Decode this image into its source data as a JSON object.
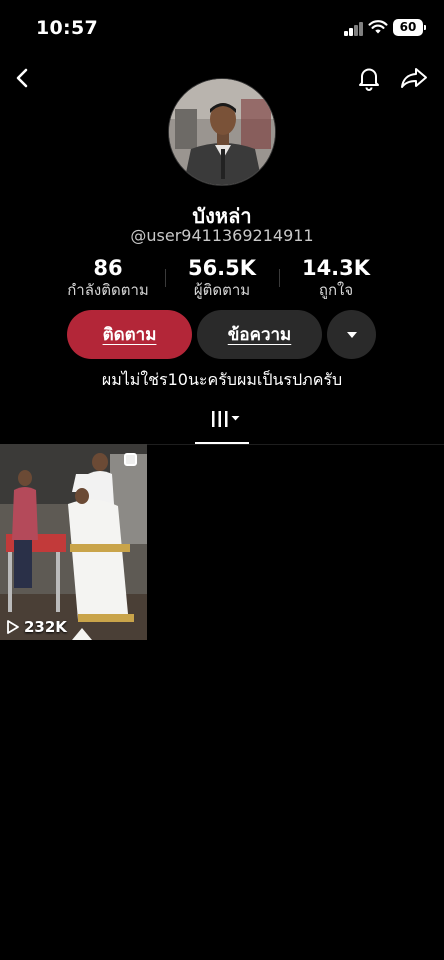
{
  "status_bar": {
    "time": "10:57",
    "battery": "60"
  },
  "profile": {
    "display_name": "บังหล่า",
    "username": "@user9411369214911",
    "bio": "ผมไม่ใช่ร10นะครับผมเป็นรปภครับ"
  },
  "stats": [
    {
      "value": "86",
      "label": "กำลังติดตาม"
    },
    {
      "value": "56.5K",
      "label": "ผู้ติดตาม"
    },
    {
      "value": "14.3K",
      "label": "ถูกใจ"
    }
  ],
  "actions": {
    "follow_label": "ติดตาม",
    "message_label": "ข้อความ"
  },
  "videos": [
    {
      "views": "232K"
    }
  ],
  "colors": {
    "follow": "#b32638",
    "secondary_button": "#2a2a2a",
    "background": "#000000"
  },
  "icons": [
    "back-icon",
    "bell-icon",
    "share-icon",
    "chevron-down-icon",
    "grid-icon",
    "play-icon",
    "pin-icon"
  ]
}
